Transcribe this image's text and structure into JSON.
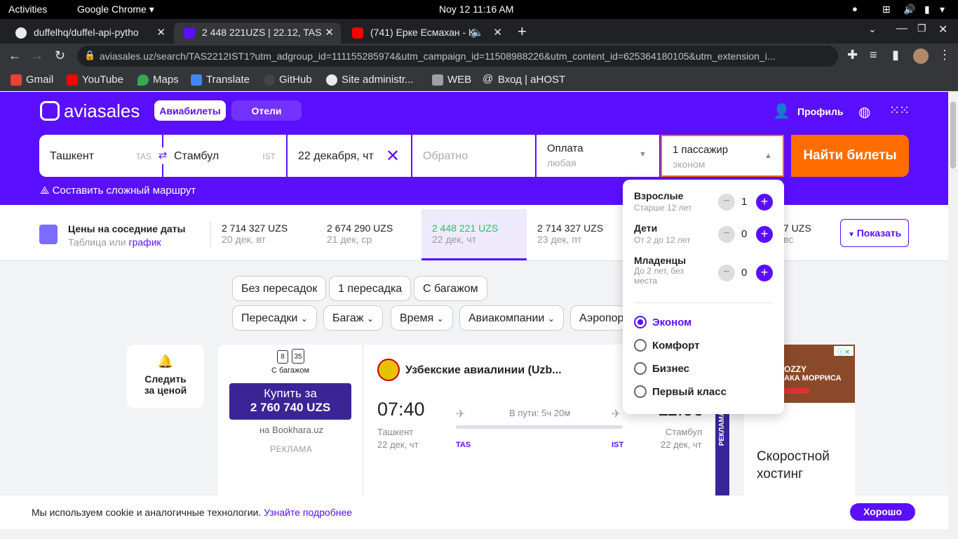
{
  "os": {
    "activities": "Activities",
    "app": "Google Chrome ▾",
    "clock": "Noy 12  11:16 AM"
  },
  "tabs": [
    {
      "title": "duffelhq/duffel-api-pytho",
      "color": "#e8eaed"
    },
    {
      "title": "2 448 221UZS | 22.12, TAS",
      "color": "#5b0fff"
    },
    {
      "title": "(741) Ерке Есмахан - К",
      "color": "#ff0000"
    }
  ],
  "omnibox": {
    "url": "aviasales.uz/search/TAS2212IST1?utm_adgroup_id=111155285974&utm_campaign_id=11508988226&utm_content_id=625364180105&utm_extension_i..."
  },
  "bookmarks": [
    {
      "label": "Gmail",
      "color": "#ea4335"
    },
    {
      "label": "YouTube",
      "color": "#ff0000"
    },
    {
      "label": "Maps",
      "color": "#34a853"
    },
    {
      "label": "Translate",
      "color": "#4285f4"
    },
    {
      "label": "GitHub",
      "color": "#444"
    },
    {
      "label": "Site administr...",
      "color": "#888"
    },
    {
      "label": "WEB",
      "color": "#aaa"
    },
    {
      "label": "Вход | aHOST",
      "color": "#666"
    }
  ],
  "site": {
    "logo": "aviasales",
    "tab_flights": "Авиабилеты",
    "tab_hotels": "Отели",
    "profile": "Профиль"
  },
  "search": {
    "from": "Ташкент",
    "from_code": "TAS",
    "to": "Стамбул",
    "to_code": "IST",
    "date": "22 декабря, чт",
    "return_placeholder": "Обратно",
    "payment": "Оплата",
    "payment_sub": "любая",
    "passengers": "1 пассажир",
    "passengers_sub": "эконом",
    "button": "Найти билеты",
    "complex_route": "Составить сложный маршрут"
  },
  "dates": {
    "title": "Цены на соседние даты",
    "subtitle_table": "Таблица",
    "subtitle_or": "или",
    "subtitle_chart": "график",
    "items": [
      {
        "price": "2 714 327 UZS",
        "date": "20 дек, вт"
      },
      {
        "price": "2 674 290 UZS",
        "date": "21 дек, ср"
      },
      {
        "price": "2 448 221 UZS",
        "date": "22 дек, чт"
      },
      {
        "price": "2 714 327 UZS",
        "date": "23 дек, пт"
      },
      {
        "price": "7 UZS",
        "date": "вс"
      }
    ],
    "show": "Показать"
  },
  "filters": {
    "quick": [
      "Без пересадок",
      "1 пересадка",
      "С багажом"
    ],
    "dropdowns": [
      "Пересадки",
      "Багаж",
      "Время",
      "Авиакомпании",
      "Аэропор"
    ]
  },
  "subscribe": {
    "label1": "Следить",
    "label2": "за ценой"
  },
  "ticket": {
    "baggage": "С багажом",
    "baggage_kg": "35",
    "handbag_kg": "8",
    "buy_line1": "Купить за",
    "buy_line2": "2 760 740 UZS",
    "seller": "на Bookhara.uz",
    "ad": "РЕКЛАМА",
    "airline": "Узбекские авиалинии (Uzb...",
    "dep_time": "07:40",
    "dep_city": "Ташкент",
    "dep_date": "22 дек, чт",
    "arr_time": "11:00",
    "arr_city": "Стамбул",
    "arr_date": "22 дек, чт",
    "duration": "В пути: 5ч 20м",
    "from_code": "TAS",
    "to_code": "IST",
    "side_label": "РЕКЛАМА"
  },
  "banner": {
    "title_line1": "Скоростной",
    "title_line2": "хостинг",
    "img_line1": "OZZY",
    "img_line2": "АКА МОРРИСА"
  },
  "passengers_popup": {
    "adults": {
      "label": "Взрослые",
      "hint": "Старше 12 лет",
      "count": "1"
    },
    "children": {
      "label": "Дети",
      "hint": "От 2 до 12 лет",
      "count": "0"
    },
    "infants": {
      "label": "Младенцы",
      "hint1": "До 2 лет, без",
      "hint2": "места",
      "count": "0"
    },
    "classes": [
      "Эконом",
      "Комфорт",
      "Бизнес",
      "Первый класс"
    ],
    "selected_class": "Эконом"
  },
  "cookie": {
    "text": "Мы используем cookie и аналогичные технологии.",
    "link": "Узнайте подробнее",
    "ok": "Хорошо"
  },
  "accent": "#5b0fff",
  "cta_color": "#ff6d00"
}
